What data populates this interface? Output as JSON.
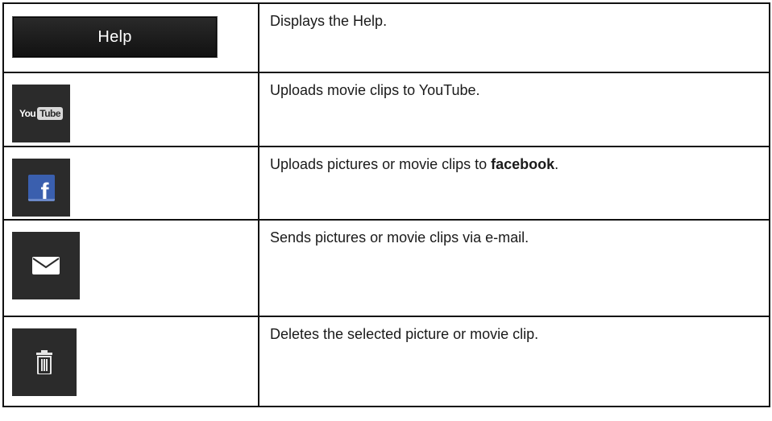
{
  "rows": [
    {
      "icon": "help-button",
      "button_label": "Help",
      "description": "Displays the Help."
    },
    {
      "icon": "youtube-icon",
      "logo_you": "You",
      "logo_tube": "Tube",
      "description": "Uploads movie clips to YouTube."
    },
    {
      "icon": "facebook-icon",
      "logo_letter": "f",
      "description_prefix": "Uploads pictures or movie clips to ",
      "description_bold": "facebook",
      "description_suffix": "."
    },
    {
      "icon": "mail-icon",
      "description": "Sends pictures or movie clips via e-mail."
    },
    {
      "icon": "trash-icon",
      "description": "Deletes the selected picture or movie clip."
    }
  ],
  "colors": {
    "tile_background": "#2b2b2b",
    "facebook_blue": "#3a5fae",
    "border": "#111111"
  }
}
